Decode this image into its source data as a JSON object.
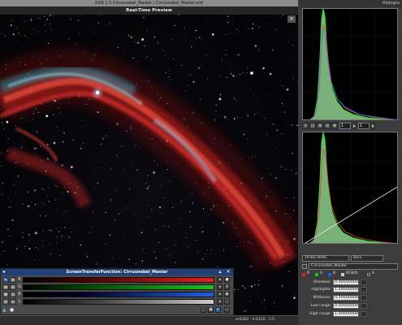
{
  "main_window": {
    "title": "RGB 1:5  Cirrusnebel_Master | Cirrusnebel_Master.xisf",
    "preview_label": "Real-Time Preview",
    "close_glyph": "✕"
  },
  "status_bar": {
    "coords": "w:8162 · h:6120 · 1:5"
  },
  "stf": {
    "title": "ScreenTransferFunction: Cirrusnebel_Master",
    "channels": [
      {
        "label": "R",
        "color": "#e02020"
      },
      {
        "label": "G",
        "color": "#20c020"
      },
      {
        "label": "B",
        "color": "#2060e0"
      },
      {
        "label": "L",
        "color": "#bbbbbb"
      }
    ],
    "left_tools": [
      "edit-icon",
      "pointer-icon",
      "zoom-in-icon",
      "zoom-out-icon",
      "pan-icon",
      "crosshair-icon",
      "move-icon",
      "stretch-icon"
    ],
    "left_glyphs": [
      "✎",
      "➤",
      "⊕",
      "⊖",
      "✥",
      "⊙",
      "✢",
      "⇔"
    ],
    "bottom_glyphs": [
      "▢",
      "▣",
      "✔",
      "▭"
    ]
  },
  "histogram": {
    "title": "Histogra",
    "zoom_h": "1",
    "zoom_v": "1",
    "bit_depth": "16-bit (64K)",
    "mode": "Bars",
    "view_name": "Cirrusnebel_Master",
    "channels": [
      {
        "label": "R",
        "color": "#e02020",
        "checked": true
      },
      {
        "label": "G",
        "color": "#20c020",
        "checked": true
      },
      {
        "label": "B",
        "color": "#2060e0",
        "checked": true
      },
      {
        "label": "RGB/K",
        "color": "#cccccc",
        "checked": true
      },
      {
        "label": "A",
        "color": "#888888",
        "checked": false
      }
    ],
    "shadows_label": "Shadows:",
    "shadows_value": "0.00000000",
    "highlights_label": "Highlights:",
    "highlights_value": "1.00000000",
    "midtones_label": "Midtones:",
    "midtones_value": "0.50000000",
    "low_range_label": "Low range:",
    "low_range_value": "0.00000000",
    "high_range_label": "High range:",
    "high_range_value": "1.00000000"
  }
}
